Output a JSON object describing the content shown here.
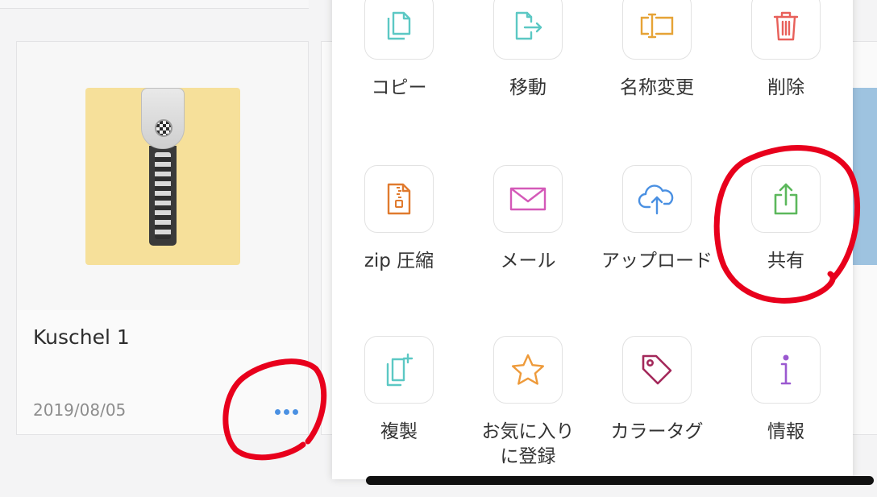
{
  "file_card": {
    "name": "Kuschel 1",
    "date": "2019/08/05",
    "thumbnail_icon": "zip-archive-icon",
    "more_icon": "more-dots-icon"
  },
  "action_sheet": {
    "rows": [
      [
        {
          "label": "コピー",
          "icon": "copy-icon",
          "color": "#5cc8c4"
        },
        {
          "label": "移動",
          "icon": "move-icon",
          "color": "#5cc8c4"
        },
        {
          "label": "名称変更",
          "icon": "rename-icon",
          "color": "#e6a336"
        },
        {
          "label": "削除",
          "icon": "trash-icon",
          "color": "#e8605a"
        }
      ],
      [
        {
          "label": "zip 圧縮",
          "icon": "zip-file-icon",
          "color": "#e07a2e"
        },
        {
          "label": "メール",
          "icon": "mail-icon",
          "color": "#d459b8"
        },
        {
          "label": "アップロード",
          "icon": "cloud-upload-icon",
          "color": "#4a90e2"
        },
        {
          "label": "共有",
          "icon": "share-icon",
          "color": "#5cb85c"
        }
      ],
      [
        {
          "label": "複製",
          "icon": "duplicate-icon",
          "color": "#5cc8c4"
        },
        {
          "label": "お気に入りに登録",
          "icon": "star-icon",
          "color": "#ee9a3a"
        },
        {
          "label": "カラータグ",
          "icon": "tag-icon",
          "color": "#a3285a"
        },
        {
          "label": "情報",
          "icon": "info-icon",
          "color": "#9b59d0"
        }
      ]
    ]
  },
  "annotation_color": "#e8001c"
}
